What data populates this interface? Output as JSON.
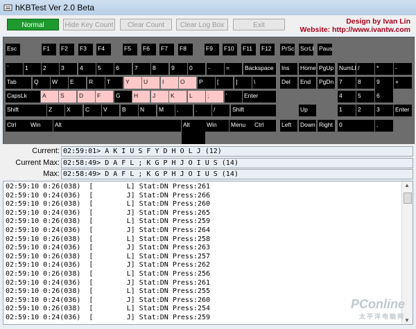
{
  "window": {
    "title": "hKBTest Ver 2.0 Beta"
  },
  "toolbar": {
    "buttons": [
      {
        "label": "Normal",
        "active": true
      },
      {
        "label": "Hide Key Count",
        "active": false
      },
      {
        "label": "Clear Count",
        "active": false
      },
      {
        "label": "Clear Log Box",
        "active": false
      },
      {
        "label": "Exit",
        "active": false
      }
    ],
    "credit_line1": "Design by Ivan Lin",
    "credit_line2": "Website: http://www.ivantw.com"
  },
  "keyboard": {
    "keys": [
      {
        "label": "Esc",
        "hl": false
      },
      {
        "label": "F1",
        "hl": false
      },
      {
        "label": "F2",
        "hl": false
      },
      {
        "label": "F3",
        "hl": false
      },
      {
        "label": "F4",
        "hl": false
      },
      {
        "label": "F5",
        "hl": false
      },
      {
        "label": "F6",
        "hl": false
      },
      {
        "label": "F7",
        "hl": false
      },
      {
        "label": "F8",
        "hl": false
      },
      {
        "label": "F9",
        "hl": false
      },
      {
        "label": "F10",
        "hl": false
      },
      {
        "label": "F11",
        "hl": false
      },
      {
        "label": "F12",
        "hl": false
      },
      {
        "label": "PrScr",
        "hl": false
      },
      {
        "label": "ScrLk",
        "hl": false
      },
      {
        "label": "Pause",
        "hl": false
      },
      {
        "label": "`",
        "hl": false
      },
      {
        "label": "1",
        "hl": false
      },
      {
        "label": "2",
        "hl": false
      },
      {
        "label": "3",
        "hl": false
      },
      {
        "label": "4",
        "hl": false
      },
      {
        "label": "5",
        "hl": false
      },
      {
        "label": "6",
        "hl": false
      },
      {
        "label": "7",
        "hl": false
      },
      {
        "label": "8",
        "hl": false
      },
      {
        "label": "9",
        "hl": false
      },
      {
        "label": "0",
        "hl": false
      },
      {
        "label": "-",
        "hl": false
      },
      {
        "label": "=",
        "hl": false
      },
      {
        "label": "Backspace",
        "hl": false
      },
      {
        "label": "Ins",
        "hl": false
      },
      {
        "label": "Home",
        "hl": false
      },
      {
        "label": "PgUp",
        "hl": false
      },
      {
        "label": "NumLk",
        "hl": false
      },
      {
        "label": "/",
        "hl": false
      },
      {
        "label": "*",
        "hl": false
      },
      {
        "label": "-",
        "hl": false
      },
      {
        "label": "Tab",
        "hl": false
      },
      {
        "label": "Q",
        "hl": false
      },
      {
        "label": "W",
        "hl": false
      },
      {
        "label": "E",
        "hl": false
      },
      {
        "label": "R",
        "hl": false
      },
      {
        "label": "T",
        "hl": false
      },
      {
        "label": "Y",
        "hl": true
      },
      {
        "label": "U",
        "hl": true
      },
      {
        "label": "I",
        "hl": true
      },
      {
        "label": "O",
        "hl": true
      },
      {
        "label": "P",
        "hl": false
      },
      {
        "label": "[",
        "hl": false
      },
      {
        "label": "]",
        "hl": false
      },
      {
        "label": "\\",
        "hl": false
      },
      {
        "label": "Del",
        "hl": false
      },
      {
        "label": "End",
        "hl": false
      },
      {
        "label": "PgDn",
        "hl": false
      },
      {
        "label": "7",
        "hl": false
      },
      {
        "label": "8",
        "hl": false
      },
      {
        "label": "9",
        "hl": false
      },
      {
        "label": "+",
        "hl": false
      },
      {
        "label": "CapsLk",
        "hl": false
      },
      {
        "label": "A",
        "hl": true
      },
      {
        "label": "S",
        "hl": true
      },
      {
        "label": "D",
        "hl": true
      },
      {
        "label": "F",
        "hl": true
      },
      {
        "label": "G",
        "hl": false
      },
      {
        "label": "H",
        "hl": true
      },
      {
        "label": "J",
        "hl": true
      },
      {
        "label": "K",
        "hl": true
      },
      {
        "label": "L",
        "hl": true
      },
      {
        "label": ";",
        "hl": true
      },
      {
        "label": "'",
        "hl": false
      },
      {
        "label": "Enter",
        "hl": false
      },
      {
        "label": "4",
        "hl": false
      },
      {
        "label": "5",
        "hl": false
      },
      {
        "label": "6",
        "hl": false
      },
      {
        "label": "Shift",
        "hl": false
      },
      {
        "label": "Z",
        "hl": false
      },
      {
        "label": "X",
        "hl": false
      },
      {
        "label": "C",
        "hl": false
      },
      {
        "label": "V",
        "hl": false
      },
      {
        "label": "B",
        "hl": false
      },
      {
        "label": "N",
        "hl": false
      },
      {
        "label": "M",
        "hl": false
      },
      {
        "label": ",",
        "hl": false
      },
      {
        "label": ".",
        "hl": false
      },
      {
        "label": "/",
        "hl": false
      },
      {
        "label": "Shift",
        "hl": false
      },
      {
        "label": "Up",
        "hl": false
      },
      {
        "label": "1",
        "hl": false
      },
      {
        "label": "2",
        "hl": false
      },
      {
        "label": "3",
        "hl": false
      },
      {
        "label": "Enter",
        "hl": false
      },
      {
        "label": "Ctrl",
        "hl": false
      },
      {
        "label": "Win",
        "hl": false
      },
      {
        "label": "Alt",
        "hl": false
      },
      {
        "label": "",
        "hl": false
      },
      {
        "label": "Alt",
        "hl": false
      },
      {
        "label": "Win",
        "hl": false
      },
      {
        "label": "Menu",
        "hl": false
      },
      {
        "label": "Ctrl",
        "hl": false
      },
      {
        "label": "Left",
        "hl": false
      },
      {
        "label": "Down",
        "hl": false
      },
      {
        "label": "Right",
        "hl": false
      },
      {
        "label": "0",
        "hl": false
      },
      {
        "label": ".",
        "hl": false
      }
    ]
  },
  "stats": {
    "current_label": "Current:",
    "current_value": "02:59:01> A K I U S F Y D H O L J (12)",
    "current_max_label": "Current Max:",
    "current_max_value": "02:58:49> D A F L ; K G P H J O I U S (14)",
    "max_label": "Max:",
    "max_value": "02:58:49> D A F L ; K G P H J O I U S (14)"
  },
  "log": {
    "lines": [
      "02:59:10 0:26(038)  [        L] Stat:DN Press:261",
      "02:59:10 0:24(036)  [        J] Stat:DN Press:266",
      "02:59:10 0:26(038)  [        L] Stat:DN Press:260",
      "02:59:10 0:24(036)  [        J] Stat:DN Press:265",
      "02:59:10 0:26(038)  [        L] Stat:DN Press:259",
      "02:59:10 0:24(036)  [        J] Stat:DN Press:264",
      "02:59:10 0:26(038)  [        L] Stat:DN Press:258",
      "02:59:10 0:24(036)  [        J] Stat:DN Press:263",
      "02:59:10 0:26(038)  [        L] Stat:DN Press:257",
      "02:59:10 0:24(036)  [        J] Stat:DN Press:262",
      "02:59:10 0:26(038)  [        L] Stat:DN Press:256",
      "02:59:10 0:24(036)  [        J] Stat:DN Press:261",
      "02:59:10 0:26(038)  [        L] Stat:DN Press:255",
      "02:59:10 0:24(036)  [        J] Stat:DN Press:260",
      "02:59:10 0:26(038)  [        L] Stat:DN Press:254",
      "02:59:10 0:24(036)  [        J] Stat:DN Press:259"
    ]
  },
  "watermark": {
    "text": "PConline",
    "sub": "太平洋电脑网"
  }
}
